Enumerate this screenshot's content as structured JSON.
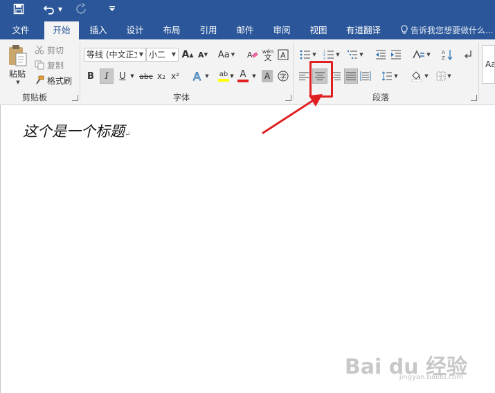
{
  "quick_access": {
    "save_icon": "save-icon",
    "undo_icon": "undo-icon",
    "redo_icon": "redo-icon",
    "customize_icon": "customize-qat-icon"
  },
  "tabs": [
    {
      "label": "文件",
      "active": false
    },
    {
      "label": "开始",
      "active": true
    },
    {
      "label": "插入",
      "active": false
    },
    {
      "label": "设计",
      "active": false
    },
    {
      "label": "布局",
      "active": false
    },
    {
      "label": "引用",
      "active": false
    },
    {
      "label": "邮件",
      "active": false
    },
    {
      "label": "审阅",
      "active": false
    },
    {
      "label": "视图",
      "active": false
    },
    {
      "label": "有道翻译",
      "active": false
    }
  ],
  "tell_me": {
    "placeholder": "告诉我您想要做什么..."
  },
  "clipboard": {
    "paste_label": "粘贴",
    "cut_label": "剪切",
    "copy_label": "复制",
    "format_painter_label": "格式刷",
    "group_label": "剪贴板"
  },
  "font": {
    "font_name": "等线 (中文正文)",
    "font_size": "小二",
    "change_case_label": "Aa",
    "bold_label": "B",
    "italic_label": "I",
    "underline_label": "U",
    "strike_label": "abc",
    "subscript_label": "x₂",
    "superscript_label": "x²",
    "phonetic_label": "wén",
    "group_label": "字体"
  },
  "paragraph": {
    "group_label": "段落",
    "active_alignment": "center"
  },
  "styles": {
    "preview_label": "Aa"
  },
  "document": {
    "text": "这个是一个标题"
  },
  "watermark": {
    "brand": "Bai du 经验",
    "url": "jingyan.baidu.com"
  },
  "colors": {
    "title_bar": "#2b579a",
    "ribbon_bg": "#f3f3f3",
    "highlight_border": "#e02020",
    "font_color_bar": "#e02020",
    "highlighter_bar": "#ffff00"
  }
}
